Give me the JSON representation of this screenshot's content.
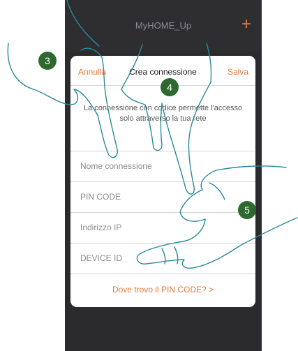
{
  "header": {
    "app_title": "MyHOME_Up",
    "add_icon": "plus-icon"
  },
  "dialog": {
    "cancel_label": "Annulla",
    "title": "Crea connessione",
    "save_label": "Salva",
    "description": "La connessione con codice permette l'accesso solo attraverso la tua rete",
    "fields": [
      {
        "placeholder": "Nome connessione"
      },
      {
        "placeholder": "PIN CODE"
      },
      {
        "placeholder": "Indirizzo IP"
      },
      {
        "placeholder": "DEVICE ID"
      }
    ],
    "help_link": "Dove trovo il PIN CODE? >"
  },
  "steps": [
    "3",
    "4",
    "5"
  ],
  "colors": {
    "accent": "#e8793a",
    "badge": "#2e6930",
    "screen_bg": "#2b2b2e"
  }
}
